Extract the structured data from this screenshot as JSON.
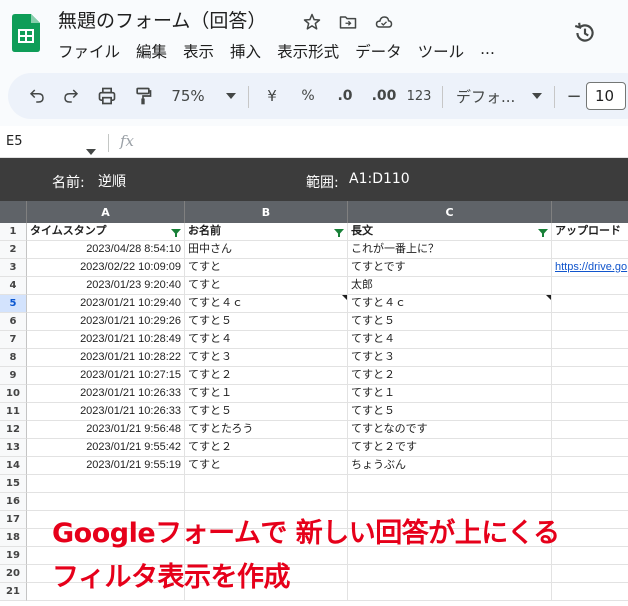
{
  "app": {
    "doc_title": "無題のフォーム（回答）",
    "menu": [
      "ファイル",
      "編集",
      "表示",
      "挿入",
      "表示形式",
      "データ",
      "ツール",
      "..."
    ]
  },
  "toolbar": {
    "zoom": "75%",
    "currency": "¥",
    "percent": "%",
    "decrease_decimal": ".0",
    "increase_decimal": ".00",
    "number_format": "123",
    "font_name": "デフォ...",
    "font_size_minus": "−",
    "font_size": "10"
  },
  "formula_bar": {
    "name_box": "E5",
    "fx_label": "fx"
  },
  "filter_view": {
    "name_label": "名前:",
    "name_value": "逆順",
    "range_label": "範囲:",
    "range_value": "A1:D110"
  },
  "sheet": {
    "column_letters": [
      "A",
      "B",
      "C"
    ],
    "header": [
      "タイムスタンプ",
      "お名前",
      "長文",
      "アップロード"
    ],
    "rows": [
      {
        "n": "2",
        "ts": "2023/04/28 8:54:10",
        "name": "田中さん",
        "text": "これが一番上に？",
        "upload": ""
      },
      {
        "n": "3",
        "ts": "2023/02/22 10:09:09",
        "name": "てすと",
        "text": "てすとです",
        "upload": "https://drive.go"
      },
      {
        "n": "4",
        "ts": "2023/01/23 9:20:40",
        "name": "てすと",
        "text": "太郎",
        "upload": ""
      },
      {
        "n": "5",
        "ts": "2023/01/21 10:29:40",
        "name": "てすと４ｃ",
        "text": "てすと４ｃ",
        "upload": ""
      },
      {
        "n": "6",
        "ts": "2023/01/21 10:29:26",
        "name": "てすと５",
        "text": "てすと５",
        "upload": ""
      },
      {
        "n": "7",
        "ts": "2023/01/21 10:28:49",
        "name": "てすと４",
        "text": "てすと４",
        "upload": ""
      },
      {
        "n": "8",
        "ts": "2023/01/21 10:28:22",
        "name": "てすと３",
        "text": "てすと３",
        "upload": ""
      },
      {
        "n": "9",
        "ts": "2023/01/21 10:27:15",
        "name": "てすと２",
        "text": "てすと２",
        "upload": ""
      },
      {
        "n": "10",
        "ts": "2023/01/21 10:26:33",
        "name": "てすと１",
        "text": "てすと１",
        "upload": ""
      },
      {
        "n": "11",
        "ts": "2023/01/21 10:26:33",
        "name": "てすと５",
        "text": "てすと５",
        "upload": ""
      },
      {
        "n": "12",
        "ts": "2023/01/21 9:56:48",
        "name": "てすとたろう",
        "text": "てすとなのです",
        "upload": ""
      },
      {
        "n": "13",
        "ts": "2023/01/21 9:55:42",
        "name": "てすと２",
        "text": "てすと２です",
        "upload": ""
      },
      {
        "n": "14",
        "ts": "2023/01/21 9:55:19",
        "name": "てすと",
        "text": "ちょうぶん",
        "upload": ""
      }
    ],
    "empty_rows": [
      "15",
      "16",
      "17",
      "18",
      "19",
      "20",
      "21"
    ],
    "selected_row": "5"
  },
  "caption": {
    "line1": "Googleフォームで 新しい回答が上にくる",
    "line2": "フィルタ表示を作成",
    "color": "#e6001a"
  },
  "colors": {
    "sheets_green": "#0f9d58",
    "filter_bar": "#3c3c3c",
    "column_header": "#5f6368",
    "link": "#1155cc"
  }
}
